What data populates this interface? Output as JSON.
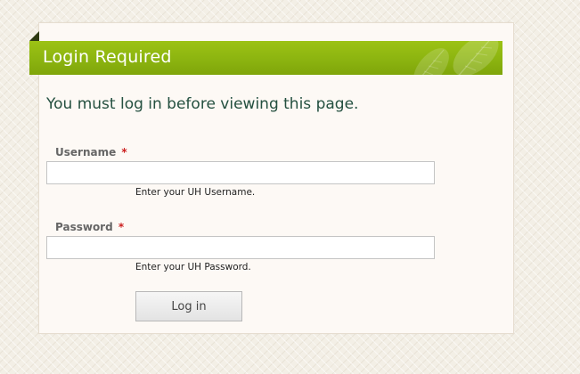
{
  "dialog": {
    "title": "Login Required",
    "intro": "You must log in before viewing this page."
  },
  "form": {
    "username": {
      "label": "Username",
      "required_marker": "*",
      "value": "",
      "help": "Enter your UH Username."
    },
    "password": {
      "label": "Password",
      "required_marker": "*",
      "value": "",
      "help": "Enter your UH Password."
    },
    "submit_label": "Log in"
  },
  "colors": {
    "title_bar": "#8cb410",
    "title_text": "#ffffff",
    "intro_text": "#245040",
    "required_marker": "#cc1f1f"
  },
  "icons": {
    "title_decoration": "leaf-decoration-icon"
  }
}
